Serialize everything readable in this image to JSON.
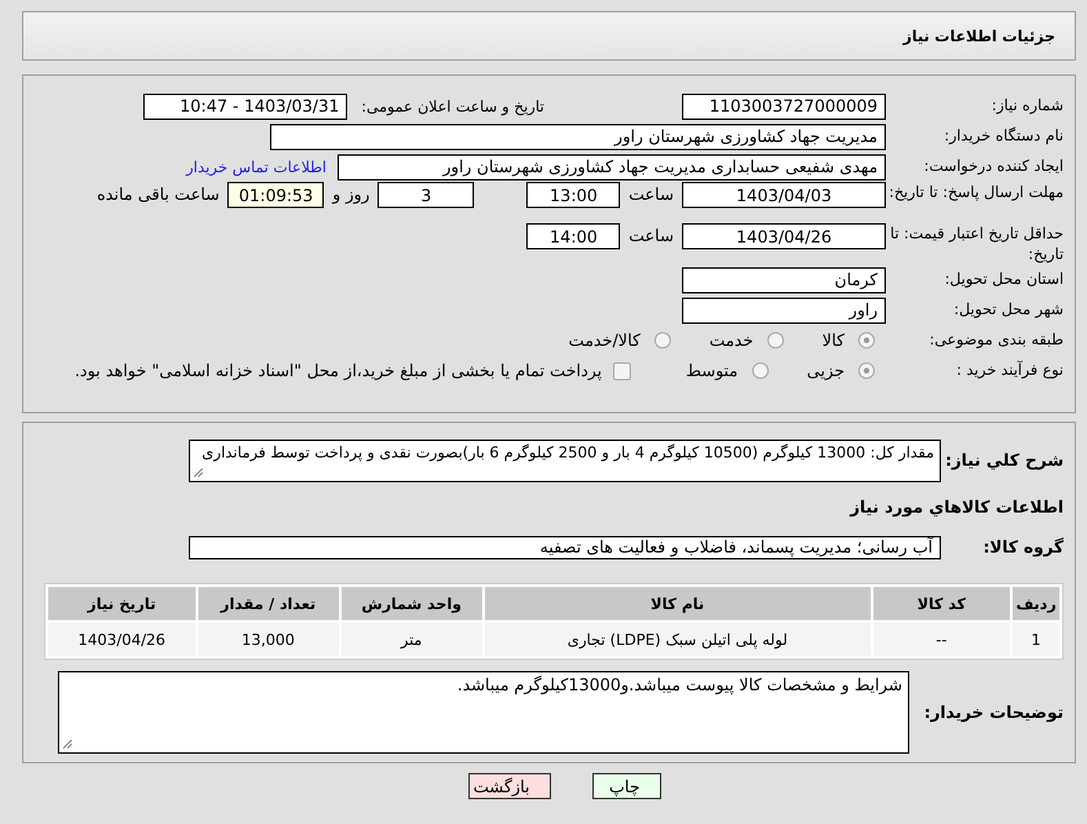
{
  "header": {
    "title": "جزئیات اطلاعات نیاز"
  },
  "need_number": {
    "label": "شماره نیاز:",
    "value": "1103003727000009"
  },
  "announce": {
    "label": "تاریخ و ساعت اعلان عمومی:",
    "value": "1403/03/31 - 10:47"
  },
  "buyer_org": {
    "label": "نام دستگاه خریدار:",
    "value": "مدیریت جهاد کشاورزی شهرستان راور"
  },
  "requester": {
    "label": "ایجاد کننده درخواست:",
    "value": "مهدی شفیعی حسابداری مدیریت جهاد کشاورزی شهرستان راور",
    "link": "اطلاعات تماس خریدار"
  },
  "response_deadline": {
    "label": "مهلت ارسال پاسخ: تا تاریخ:",
    "date": "1403/04/03",
    "time_label": "ساعت",
    "time": "13:00",
    "days": "3",
    "days_label": "روز و",
    "remaining": "01:09:53",
    "remaining_label": "ساعت باقی مانده"
  },
  "price_validity": {
    "label": "حداقل تاریخ اعتبار قیمت: تا تاریخ:",
    "date": "1403/04/26",
    "time_label": "ساعت",
    "time": "14:00"
  },
  "province": {
    "label": "استان محل تحویل:",
    "value": "کرمان"
  },
  "city": {
    "label": "شهر محل تحویل:",
    "value": "راور"
  },
  "category": {
    "label": "طبقه بندی موضوعی:",
    "options": [
      {
        "label": "کالا",
        "selected": true
      },
      {
        "label": "خدمت",
        "selected": false
      },
      {
        "label": "کالا/خدمت",
        "selected": false
      }
    ]
  },
  "process": {
    "label": "نوع فرآیند خرید :",
    "options": [
      {
        "label": "جزیی",
        "selected": true
      },
      {
        "label": "متوسط",
        "selected": false
      }
    ],
    "payment": {
      "label": "پرداخت تمام یا بخشی از مبلغ خرید،از محل \"اسناد خزانه اسلامی\" خواهد بود.",
      "checked": false
    }
  },
  "description": {
    "label": "شرح کلي نياز:",
    "value": "مقدار کل:  13000 کیلوگرم (10500 کیلوگرم 4 بار و 2500 کیلوگرم 6 بار)بصورت نقدی و پرداخت توسط فرمانداری"
  },
  "goods_title": "اطلاعات کالاهاي مورد نياز",
  "goods_group": {
    "label": "گروه کالا:",
    "value": "آب رسانی؛ مدیریت پسماند، فاضلاب و فعالیت های تصفیه"
  },
  "table": {
    "columns": [
      "ردیف",
      "کد کالا",
      "نام کالا",
      "واحد شمارش",
      "تعداد / مقدار",
      "تاریخ نیاز"
    ],
    "rows": [
      [
        "1",
        "--",
        "لوله پلی اتیلن سبک (LDPE) تجاری",
        "متر",
        "13,000",
        "1403/04/26"
      ]
    ]
  },
  "buyer_notes": {
    "label": "توضیحات خریدار:",
    "value": "شرایط و مشخصات کالا پیوست میباشد.و13000کیلوگرم میباشد."
  },
  "buttons": [
    {
      "label": "چاپ",
      "kind": "print"
    },
    {
      "label": "بازگشت",
      "kind": "back"
    }
  ]
}
